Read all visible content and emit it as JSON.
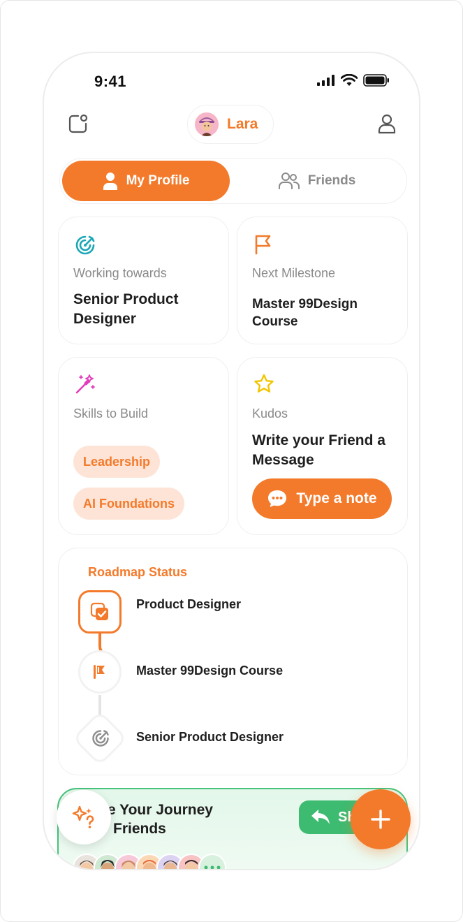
{
  "status_bar": {
    "time": "9:41"
  },
  "header": {
    "user_name": "Lara",
    "left_icon": "notification-square-icon",
    "right_icon": "user-outline-icon"
  },
  "tabs": [
    {
      "label": "My Profile",
      "icon": "user-icon",
      "active": true
    },
    {
      "label": "Friends",
      "icon": "users-icon",
      "active": false
    }
  ],
  "cards": {
    "working_towards": {
      "label": "Working towards",
      "title": "Senior Product Designer",
      "icon": "target-icon"
    },
    "next_milestone": {
      "label": "Next Milestone",
      "title": "Master 99Design Course",
      "icon": "flag-icon"
    },
    "skills": {
      "label": "Skills to Build",
      "pills": [
        "Leadership",
        "AI Foundations"
      ],
      "icon": "magic-wand-icon"
    },
    "kudos": {
      "label": "Kudos",
      "title": "Write your Friend a Message",
      "button": "Type a note",
      "icon": "star-icon"
    }
  },
  "roadmap": {
    "title": "Roadmap Status",
    "steps": [
      {
        "label": "Product Designer",
        "icon": "checked-cards-icon",
        "state": "done"
      },
      {
        "label": "Master 99Design Course",
        "icon": "flag-icon",
        "state": "current"
      },
      {
        "label": "Senior Product Designer",
        "icon": "target-icon",
        "state": "upcoming"
      }
    ]
  },
  "share": {
    "title_line1": "e Your Journey",
    "title_line2": "Friends",
    "button_partial": "Sh"
  },
  "colors": {
    "accent": "#f47a2b",
    "accent_soft": "#fde4d6",
    "green": "#3dbb71",
    "teal": "#1aa6b7",
    "pink": "#e23dbd",
    "yellow": "#f2c500"
  }
}
